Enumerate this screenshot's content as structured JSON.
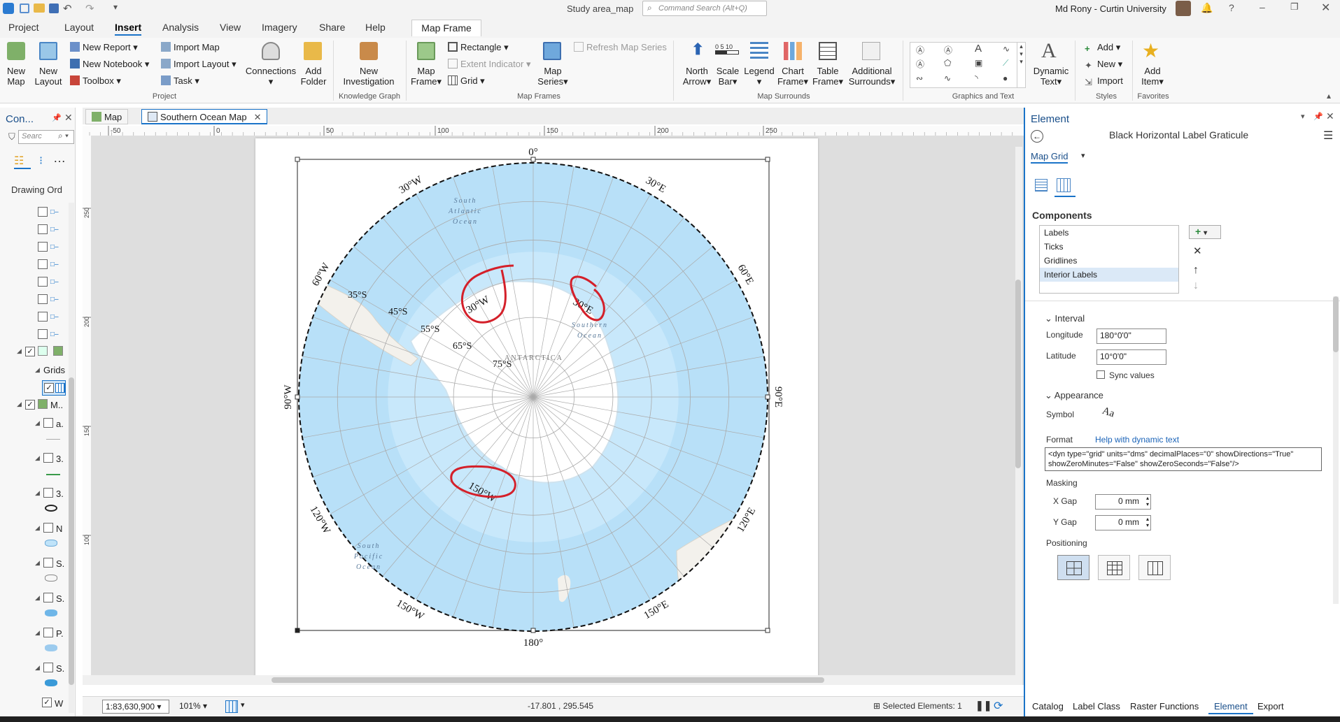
{
  "window": {
    "title": "Study area_map",
    "search_placeholder": "Command Search (Alt+Q)",
    "user": "Md Rony - Curtin University"
  },
  "ribbon_tabs": [
    "Project",
    "Layout",
    "Insert",
    "Analysis",
    "View",
    "Imagery",
    "Share",
    "Help"
  ],
  "context_tab": "Map Frame",
  "ribbon": {
    "new_map": [
      "New",
      "Map"
    ],
    "new_layout": [
      "New",
      "Layout"
    ],
    "new_report": "New Report",
    "new_notebook": "New Notebook",
    "toolbox": "Toolbox",
    "import_map": "Import Map",
    "import_layout": "Import Layout",
    "task": "Task",
    "connections": "Connections",
    "add_folder": [
      "Add",
      "Folder"
    ],
    "new_investigation": [
      "New",
      "Investigation"
    ],
    "map_frame": [
      "Map",
      "Frame"
    ],
    "rectangle": "Rectangle",
    "extent_indicator": "Extent Indicator",
    "grid": "Grid",
    "map_series": [
      "Map",
      "Series"
    ],
    "refresh_map_series": "Refresh Map Series",
    "north_arrow": [
      "North",
      "Arrow"
    ],
    "scale_bar": [
      "Scale",
      "Bar"
    ],
    "scale_icon_text": "0 5 10",
    "legend": "Legend",
    "chart_frame": [
      "Chart",
      "Frame"
    ],
    "table_frame": [
      "Table",
      "Frame"
    ],
    "additional_surrounds": [
      "Additional",
      "Surrounds"
    ],
    "dynamic_text": [
      "Dynamic",
      "Text"
    ],
    "add": "Add",
    "new": "New",
    "import": "Import",
    "add_item": [
      "Add",
      "Item"
    ],
    "groups": [
      "Project",
      "Knowledge Graph",
      "Map Frames",
      "Map Surrounds",
      "Graphics and Text",
      "Styles",
      "Favorites"
    ]
  },
  "contents": {
    "title": "Con...",
    "search_placeholder": "Searc",
    "drawing_order": "Drawing Ord",
    "grids": "Grids",
    "items": [
      "M..",
      "a.",
      "3.",
      "3.",
      "N",
      "S.",
      "S.",
      "P.",
      "S.",
      "W"
    ]
  },
  "doc_tabs": [
    "Map",
    "Southern Ocean Map"
  ],
  "ruler_labels": [
    "-50",
    "0",
    "50",
    "100",
    "150",
    "200",
    "250"
  ],
  "vruler_labels": [
    "250",
    "200",
    "150",
    "100"
  ],
  "map": {
    "outer_labels": [
      {
        "t": "0°",
        "a": 0
      },
      {
        "t": "30°E",
        "a": 30
      },
      {
        "t": "60°E",
        "a": 60
      },
      {
        "t": "90°E",
        "a": 90
      },
      {
        "t": "120°E",
        "a": 120
      },
      {
        "t": "150°E",
        "a": 150
      },
      {
        "t": "180°",
        "a": 180
      },
      {
        "t": "150°W",
        "a": -150
      },
      {
        "t": "120°W",
        "a": -120
      },
      {
        "t": "90°W",
        "a": -90
      },
      {
        "t": "60°W",
        "a": -60
      },
      {
        "t": "30°W",
        "a": -30
      }
    ],
    "lat_labels": [
      "35°S",
      "45°S",
      "55°S",
      "65°S",
      "75°S"
    ],
    "interior_labels": [
      "30°W",
      "30°E",
      "150°W"
    ],
    "ocean_labels": [
      [
        "South",
        "Atlantic",
        "Ocean"
      ],
      [
        "Southern",
        "Ocean"
      ],
      [
        "South",
        "Pacific",
        "Ocean"
      ]
    ],
    "antarctica": "ANTARCTICA"
  },
  "status": {
    "scale": "1:83,630,900",
    "zoom": "101%",
    "coords": "-17.801 , 295.545",
    "selected": "Selected Elements: 1"
  },
  "element_pane": {
    "title": "Element",
    "subtitle": "Black Horizontal Label Graticule",
    "dropdown": "Map Grid",
    "components_label": "Components",
    "components": [
      "Labels",
      "Ticks",
      "Gridlines",
      "Interior Labels"
    ],
    "interval_label": "Interval",
    "longitude_label": "Longitude",
    "longitude_value": "180°0'0\"",
    "latitude_label": "Latitude",
    "latitude_value": "10°0'0\"",
    "sync_values": "Sync values",
    "appearance_label": "Appearance",
    "symbol_label": "Symbol",
    "symbol_glyph": "Aa",
    "format_label": "Format",
    "format_link": "Help with dynamic text",
    "format_line1": "<dyn type=\"grid\" units=\"dms\" decimalPlaces=\"0\" showDirections=\"True\"",
    "format_line2": "showZeroMinutes=\"False\" showZeroSeconds=\"False\"/>",
    "masking_label": "Masking",
    "xgap_label": "X Gap",
    "xgap_value": "0 mm",
    "ygap_label": "Y Gap",
    "ygap_value": "0 mm",
    "positioning_label": "Positioning"
  },
  "bottom_tabs": [
    "Catalog",
    "Label Class",
    "Raster Functions",
    "Element",
    "Export"
  ],
  "colors": {
    "accent": "#1a73c8",
    "ocean": "#bfe3f9",
    "annotation": "#d4202a"
  }
}
